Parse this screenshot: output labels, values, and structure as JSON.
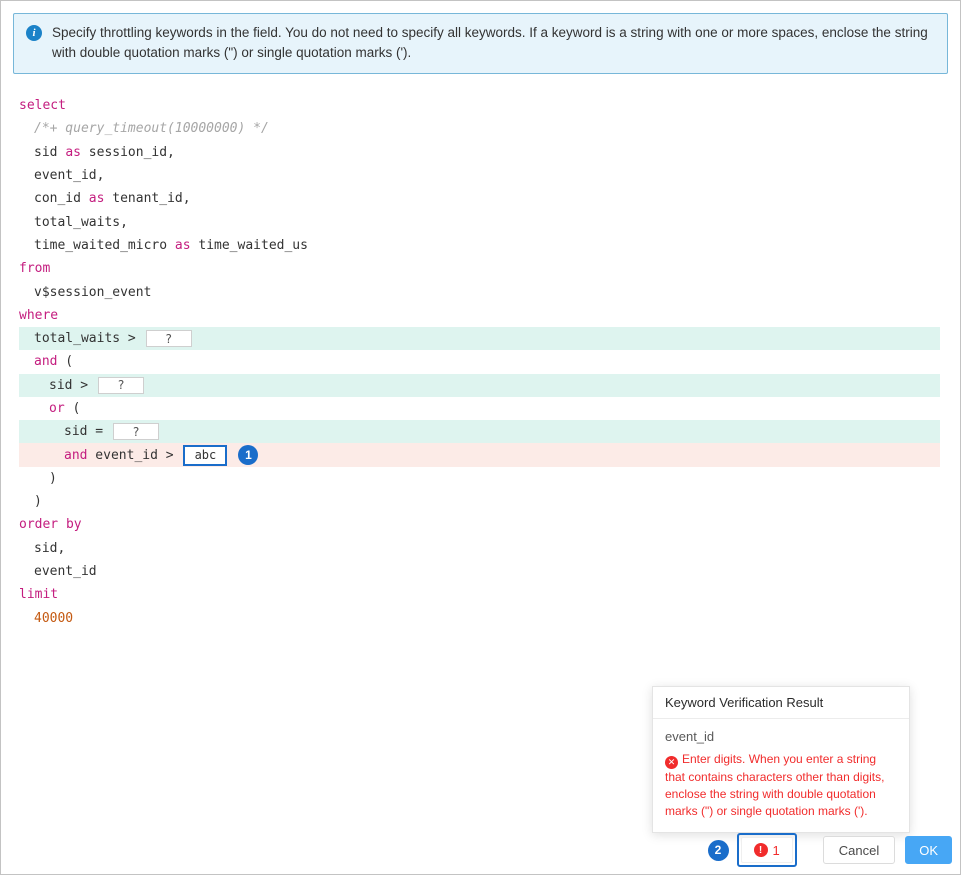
{
  "colors": {
    "accent_blue": "#1a6dca",
    "ok_blue": "#47a7f5",
    "error_red": "#f12c2c",
    "keyword_magenta": "#c41d7f",
    "number_orange": "#c45911",
    "row_highlight_cyan": "#def4ef",
    "row_highlight_pink": "#fcebe7",
    "banner_bg": "#e7f4fb",
    "banner_border": "#77b7d9"
  },
  "banner": {
    "icon": "info-icon",
    "text": "Specify throttling keywords in the field. You do not need to specify all keywords. If a keyword is a string with one or more spaces, enclose the string with double quotation marks (\") or single quotation marks (')."
  },
  "sql": {
    "lines": [
      {
        "indent": 0,
        "bg": "",
        "tokens": [
          {
            "t": "kw",
            "s": "select"
          }
        ]
      },
      {
        "indent": 1,
        "bg": "",
        "tokens": [
          {
            "t": "cm",
            "s": "/*+ query_timeout(10000000) */"
          }
        ]
      },
      {
        "indent": 1,
        "bg": "",
        "tokens": [
          {
            "t": "txt",
            "s": "sid "
          },
          {
            "t": "kw",
            "s": "as"
          },
          {
            "t": "txt",
            "s": " session_id,"
          }
        ]
      },
      {
        "indent": 1,
        "bg": "",
        "tokens": [
          {
            "t": "txt",
            "s": "event_id,"
          }
        ]
      },
      {
        "indent": 1,
        "bg": "",
        "tokens": [
          {
            "t": "txt",
            "s": "con_id "
          },
          {
            "t": "kw",
            "s": "as"
          },
          {
            "t": "txt",
            "s": " tenant_id,"
          }
        ]
      },
      {
        "indent": 1,
        "bg": "",
        "tokens": [
          {
            "t": "txt",
            "s": "total_waits,"
          }
        ]
      },
      {
        "indent": 1,
        "bg": "",
        "tokens": [
          {
            "t": "txt",
            "s": "time_waited_micro "
          },
          {
            "t": "kw",
            "s": "as"
          },
          {
            "t": "txt",
            "s": " time_waited_us"
          }
        ]
      },
      {
        "indent": 0,
        "bg": "",
        "tokens": [
          {
            "t": "kw",
            "s": "from"
          }
        ]
      },
      {
        "indent": 1,
        "bg": "",
        "tokens": [
          {
            "t": "txt",
            "s": "v$session_event"
          }
        ]
      },
      {
        "indent": 0,
        "bg": "",
        "tokens": [
          {
            "t": "kw",
            "s": "where"
          }
        ]
      },
      {
        "indent": 1,
        "bg": "cyan",
        "tokens": [
          {
            "t": "txt",
            "s": "total_waits > "
          },
          {
            "t": "input",
            "s": "?",
            "name": "keyword-input-total-waits"
          }
        ]
      },
      {
        "indent": 1,
        "bg": "",
        "tokens": [
          {
            "t": "kw",
            "s": "and"
          },
          {
            "t": "txt",
            "s": " ("
          }
        ]
      },
      {
        "indent": 2,
        "bg": "cyan",
        "tokens": [
          {
            "t": "txt",
            "s": "sid > "
          },
          {
            "t": "input",
            "s": "?",
            "name": "keyword-input-sid-gt"
          }
        ]
      },
      {
        "indent": 2,
        "bg": "",
        "tokens": [
          {
            "t": "kw",
            "s": "or"
          },
          {
            "t": "txt",
            "s": " ("
          }
        ]
      },
      {
        "indent": 3,
        "bg": "cyan",
        "tokens": [
          {
            "t": "txt",
            "s": "sid = "
          },
          {
            "t": "input",
            "s": "?",
            "name": "keyword-input-sid-eq"
          }
        ]
      },
      {
        "indent": 3,
        "bg": "pink",
        "tokens": [
          {
            "t": "kw",
            "s": "and"
          },
          {
            "t": "txt",
            "s": " event_id > "
          },
          {
            "t": "input",
            "s": "abc",
            "focus": true,
            "name": "keyword-input-event-id"
          },
          {
            "t": "badge",
            "s": "1"
          }
        ]
      },
      {
        "indent": 2,
        "bg": "",
        "tokens": [
          {
            "t": "txt",
            "s": ")"
          }
        ]
      },
      {
        "indent": 1,
        "bg": "",
        "tokens": [
          {
            "t": "txt",
            "s": ")"
          }
        ]
      },
      {
        "indent": 0,
        "bg": "",
        "tokens": [
          {
            "t": "kw",
            "s": "order by"
          }
        ]
      },
      {
        "indent": 1,
        "bg": "",
        "tokens": [
          {
            "t": "txt",
            "s": "sid,"
          }
        ]
      },
      {
        "indent": 1,
        "bg": "",
        "tokens": [
          {
            "t": "txt",
            "s": "event_id"
          }
        ]
      },
      {
        "indent": 0,
        "bg": "",
        "tokens": [
          {
            "t": "kw",
            "s": "limit"
          }
        ]
      },
      {
        "indent": 1,
        "bg": "",
        "tokens": [
          {
            "t": "num",
            "s": "40000"
          }
        ]
      }
    ]
  },
  "popover": {
    "title": "Keyword Verification Result",
    "keyword": "event_id",
    "error_icon": "circle-x-icon",
    "message": "Enter digits. When you enter a string that contains characters other than digits, enclose the string with double quotation marks (\") or single quotation marks (')."
  },
  "footer": {
    "error_count": "1",
    "cancel_label": "Cancel",
    "ok_label": "OK"
  },
  "callouts": {
    "one": "1",
    "two": "2"
  }
}
